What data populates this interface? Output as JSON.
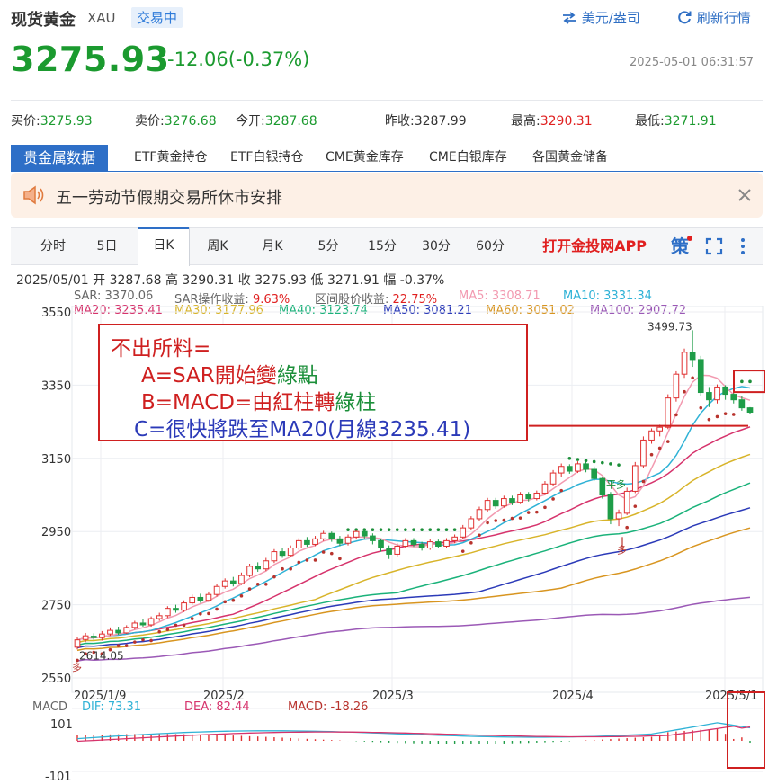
{
  "header": {
    "title": "现货黄金",
    "code": "XAU",
    "status": "交易中",
    "currency_link": "美元/盎司",
    "refresh_link": "刷新行情",
    "price": "3275.93",
    "change": "-12.06(-0.37%)",
    "timestamp": "2025-05-01 06:31:57"
  },
  "quote": [
    {
      "label": "买价:",
      "value": "3275.93",
      "color": "green"
    },
    {
      "label": "卖价:",
      "value": "3276.68",
      "color": "green"
    },
    {
      "label": "今开:",
      "value": "3287.68",
      "color": "green"
    },
    {
      "label": "昨收:",
      "value": "3287.99",
      "color": "black"
    },
    {
      "label": "最高:",
      "value": "3290.31",
      "color": "red"
    },
    {
      "label": "最低:",
      "value": "3271.91",
      "color": "green"
    }
  ],
  "nav": {
    "active": "贵金属数据",
    "items": [
      "ETF黄金持仓",
      "ETF白银持仓",
      "CME黄金库存",
      "CME白银库存",
      "各国黄金储备"
    ]
  },
  "notice": {
    "text": "五一劳动节假期交易所休市安排"
  },
  "tabs": {
    "items": [
      "分时",
      "5日",
      "日K",
      "周K",
      "月K",
      "5分",
      "15分",
      "30分",
      "60分"
    ],
    "active_index": 2,
    "app_link": "打开金投网APP",
    "strategy": "策"
  },
  "bar_info": {
    "date": "2025/05/01",
    "open": "开 3287.68",
    "high": "高 3290.31",
    "close": "收 3275.93",
    "low": "低 3271.91",
    "amp": "幅 -0.37%"
  },
  "indicators": {
    "row1": [
      {
        "text": "SAR: 3370.06",
        "color": "#666666"
      },
      {
        "text": "SAR操作收益: ",
        "color": "#666666",
        "value": "9.63%",
        "value_color": "#e02020"
      },
      {
        "text": "区间股价收益: ",
        "color": "#666666",
        "value": "22.75%",
        "value_color": "#e02020"
      },
      {
        "text": "MA5: 3308.71",
        "color": "#f29ab0"
      },
      {
        "text": "MA10: 3331.34",
        "color": "#2fb2d6"
      }
    ],
    "row2": [
      {
        "text": "MA20: 3235.41",
        "color": "#d6336c"
      },
      {
        "text": "MA30: 3177.96",
        "color": "#d8b42a"
      },
      {
        "text": "MA40: 3123.74",
        "color": "#1ab27a"
      },
      {
        "text": "MA50: 3081.21",
        "color": "#2b3ab8"
      },
      {
        "text": "MA60: 3051.02",
        "color": "#d89520"
      },
      {
        "text": "MA100: 2907.72",
        "color": "#9b59b6"
      }
    ]
  },
  "annotation": {
    "line1": "不出所料=",
    "line2": "A=SAR開始變",
    "line2b": "綠點",
    "line3": "B=MACD=由紅柱轉",
    "line3b": "綠柱",
    "line4": "C=很快將跌至MA20(月線3235.41)"
  },
  "chart_data": {
    "type": "candlestick",
    "y_ticks": [
      "3550",
      "3350",
      "3150",
      "2950",
      "2750",
      "2550"
    ],
    "ylim": [
      2550,
      3550
    ],
    "x_ticks": [
      "2025/1/9",
      "2025/2",
      "2025/3",
      "2025/4",
      "2025/5/1"
    ],
    "high_label": "3499.73",
    "low_label": "2614.05",
    "sar_labels": [
      "平多",
      "多"
    ],
    "ohlc": [
      [
        2634,
        2654,
        2628,
        2662
      ],
      [
        2655,
        2665,
        2648,
        2673
      ],
      [
        2664,
        2660,
        2654,
        2672
      ],
      [
        2660,
        2670,
        2652,
        2678
      ],
      [
        2670,
        2680,
        2665,
        2688
      ],
      [
        2680,
        2673,
        2668,
        2690
      ],
      [
        2673,
        2688,
        2670,
        2694
      ],
      [
        2688,
        2700,
        2682,
        2706
      ],
      [
        2700,
        2695,
        2690,
        2710
      ],
      [
        2695,
        2712,
        2690,
        2718
      ],
      [
        2712,
        2720,
        2706,
        2728
      ],
      [
        2720,
        2740,
        2714,
        2746
      ],
      [
        2740,
        2735,
        2728,
        2750
      ],
      [
        2735,
        2755,
        2730,
        2762
      ],
      [
        2755,
        2770,
        2750,
        2778
      ],
      [
        2770,
        2762,
        2755,
        2780
      ],
      [
        2762,
        2778,
        2758,
        2786
      ],
      [
        2778,
        2800,
        2772,
        2808
      ],
      [
        2800,
        2815,
        2794,
        2822
      ],
      [
        2815,
        2808,
        2800,
        2826
      ],
      [
        2808,
        2830,
        2804,
        2838
      ],
      [
        2830,
        2855,
        2825,
        2862
      ],
      [
        2855,
        2848,
        2840,
        2866
      ],
      [
        2848,
        2870,
        2842,
        2878
      ],
      [
        2870,
        2895,
        2864,
        2902
      ],
      [
        2895,
        2885,
        2878,
        2905
      ],
      [
        2885,
        2905,
        2880,
        2912
      ],
      [
        2905,
        2925,
        2900,
        2932
      ],
      [
        2925,
        2915,
        2908,
        2935
      ],
      [
        2915,
        2930,
        2910,
        2938
      ],
      [
        2930,
        2945,
        2924,
        2952
      ],
      [
        2945,
        2930,
        2922,
        2950
      ],
      [
        2930,
        2918,
        2910,
        2938
      ],
      [
        2918,
        2935,
        2912,
        2942
      ],
      [
        2935,
        2950,
        2928,
        2955
      ],
      [
        2950,
        2938,
        2930,
        2956
      ],
      [
        2938,
        2925,
        2915,
        2945
      ],
      [
        2925,
        2905,
        2895,
        2930
      ],
      [
        2905,
        2888,
        2875,
        2912
      ],
      [
        2888,
        2910,
        2882,
        2918
      ],
      [
        2910,
        2925,
        2904,
        2932
      ],
      [
        2925,
        2915,
        2908,
        2932
      ],
      [
        2915,
        2905,
        2898,
        2922
      ],
      [
        2905,
        2922,
        2900,
        2930
      ],
      [
        2922,
        2910,
        2904,
        2928
      ],
      [
        2910,
        2925,
        2905,
        2932
      ],
      [
        2925,
        2935,
        2918,
        2942
      ],
      [
        2935,
        2960,
        2930,
        2968
      ],
      [
        2960,
        2985,
        2955,
        2992
      ],
      [
        2985,
        3010,
        2978,
        3018
      ],
      [
        3010,
        3035,
        3004,
        3042
      ],
      [
        3035,
        3020,
        3012,
        3042
      ],
      [
        3020,
        3040,
        3015,
        3048
      ],
      [
        3040,
        3030,
        3022,
        3048
      ],
      [
        3030,
        3050,
        3025,
        3058
      ],
      [
        3050,
        3040,
        3032,
        3058
      ],
      [
        3040,
        3055,
        3035,
        3062
      ],
      [
        3055,
        3080,
        3050,
        3088
      ],
      [
        3080,
        3110,
        3075,
        3118
      ],
      [
        3110,
        3128,
        3100,
        3136
      ],
      [
        3128,
        3115,
        3108,
        3134
      ],
      [
        3115,
        3135,
        3110,
        3142
      ],
      [
        3135,
        3120,
        3112,
        3140
      ],
      [
        3120,
        3095,
        3088,
        3128
      ],
      [
        3095,
        3050,
        3040,
        3100
      ],
      [
        3050,
        2985,
        2970,
        3058
      ],
      [
        2985,
        3000,
        2965,
        3010
      ],
      [
        3000,
        3060,
        2995,
        3070
      ],
      [
        3060,
        3130,
        3055,
        3140
      ],
      [
        3130,
        3200,
        3125,
        3210
      ],
      [
        3200,
        3225,
        3190,
        3232
      ],
      [
        3225,
        3235,
        3210,
        3242
      ],
      [
        3235,
        3315,
        3230,
        3325
      ],
      [
        3315,
        3380,
        3305,
        3388
      ],
      [
        3380,
        3440,
        3370,
        3450
      ],
      [
        3440,
        3420,
        3400,
        3500
      ],
      [
        3420,
        3330,
        3320,
        3430
      ],
      [
        3330,
        3310,
        3290,
        3345
      ],
      [
        3310,
        3345,
        3300,
        3352
      ],
      [
        3345,
        3325,
        3310,
        3350
      ],
      [
        3325,
        3310,
        3300,
        3335
      ],
      [
        3310,
        3288,
        3280,
        3320
      ],
      [
        3288,
        3276,
        3272,
        3290
      ]
    ],
    "macd_ticks": [
      "101",
      "-101"
    ],
    "macd_labels": {
      "name": "MACD",
      "dif": "DIF: 73.31",
      "dea": "DEA: 82.44",
      "macd": "MACD: -18.26"
    }
  },
  "colors": {
    "up": "#e03030",
    "down": "#1f9d48",
    "accent": "#2e6fc7",
    "annot_red": "#cf2020",
    "annot_green": "#1c8f3a",
    "annot_blue": "#2b3ab8"
  }
}
